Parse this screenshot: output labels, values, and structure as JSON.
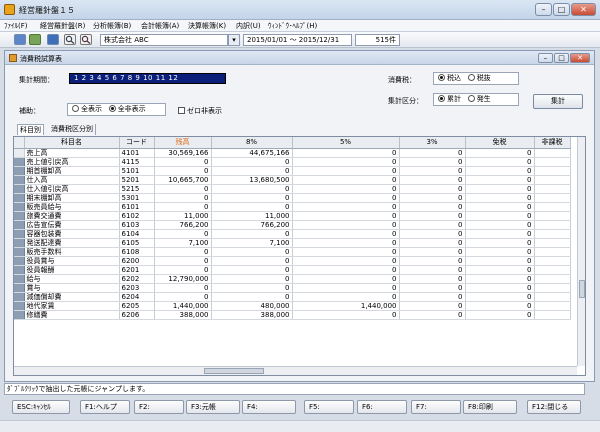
{
  "window": {
    "title": "経営羅針盤１５",
    "min": "–",
    "max": "□",
    "close": "✕"
  },
  "menu": [
    "ﾌｧｲﾙ(F)",
    "経営羅針盤(R)",
    "分析帳簿(B)",
    "会計帳簿(A)",
    "決算帳簿(K)",
    "内訳(U)",
    "ｳｨﾝﾄﾞｳ･ﾍﾙﾌﾟ(H)"
  ],
  "toolbar": {
    "company": "株式会社 ABC",
    "dropdown": "▾",
    "period": "2015/01/01 ～ 2015/12/31",
    "count": "515件"
  },
  "child": {
    "title": "消費税試算表"
  },
  "filters": {
    "period_label": "集計期間：",
    "months": "1  2  3  4  5  6  7  8  9  10  11  12",
    "aux_label": "補助：",
    "aux_all": "全表示",
    "aux_none": "全非表示",
    "zero_hide": "ゼロ非表示",
    "tax_label": "消費税：",
    "tax_incl": "税込",
    "tax_excl": "税抜",
    "agg_label": "集計区分：",
    "agg_cum": "累計",
    "agg_occ": "発生",
    "calc_button": "集計"
  },
  "tabs": [
    "科目別",
    "消費税区分別"
  ],
  "table": {
    "headers": [
      "科目名",
      "コード",
      "残高",
      "8%",
      "5%",
      "3%",
      "免税",
      "非課税"
    ],
    "rows": [
      [
        "売上高",
        "4101",
        "30,569,166",
        "44,675,166",
        "0",
        "0",
        "0"
      ],
      [
        "売上値引戻高",
        "4115",
        "0",
        "0",
        "0",
        "0",
        "0"
      ],
      [
        "期首棚卸高",
        "5101",
        "0",
        "0",
        "0",
        "0",
        "0"
      ],
      [
        "仕入高",
        "5201",
        "10,665,700",
        "13,680,500",
        "0",
        "0",
        "0"
      ],
      [
        "仕入値引戻高",
        "5215",
        "0",
        "0",
        "0",
        "0",
        "0"
      ],
      [
        "期末棚卸高",
        "5301",
        "0",
        "0",
        "0",
        "0",
        "0"
      ],
      [
        "販売員給与",
        "6101",
        "0",
        "0",
        "0",
        "0",
        "0"
      ],
      [
        "旅費交通費",
        "6102",
        "11,000",
        "11,000",
        "0",
        "0",
        "0"
      ],
      [
        "広告宣伝費",
        "6103",
        "766,200",
        "766,200",
        "0",
        "0",
        "0"
      ],
      [
        "容器包装費",
        "6104",
        "0",
        "0",
        "0",
        "0",
        "0"
      ],
      [
        "発送配達費",
        "6105",
        "7,100",
        "7,100",
        "0",
        "0",
        "0"
      ],
      [
        "販売手数料",
        "6108",
        "0",
        "0",
        "0",
        "0",
        "0"
      ],
      [
        "役員賞与",
        "6200",
        "0",
        "0",
        "0",
        "0",
        "0"
      ],
      [
        "役員報酬",
        "6201",
        "0",
        "0",
        "0",
        "0",
        "0"
      ],
      [
        "給与",
        "6202",
        "12,790,000",
        "0",
        "0",
        "0",
        "0"
      ],
      [
        "賞与",
        "6203",
        "0",
        "0",
        "0",
        "0",
        "0"
      ],
      [
        "減価償却費",
        "6204",
        "0",
        "0",
        "0",
        "0",
        "0"
      ],
      [
        "地代家賃",
        "6205",
        "1,440,000",
        "480,000",
        "1,440,000",
        "0",
        "0"
      ],
      [
        "修繕費",
        "6206",
        "388,000",
        "388,000",
        "0",
        "0",
        "0"
      ]
    ]
  },
  "status": "ﾀﾞﾌﾞﾙｸﾘｯｸで抽出した元帳にジャンプします。",
  "fkeys": [
    "ESC:ｷｬﾝｾﾙ",
    "F1:ヘルプ",
    "F2:",
    "F3:元帳",
    "F4:",
    "F5:",
    "F6:",
    "F7:",
    "F8:印刷",
    "F12:閉じる"
  ],
  "icons": [
    "save-icon",
    "open-icon",
    "mail-icon",
    "search-icon",
    "find-icon"
  ]
}
